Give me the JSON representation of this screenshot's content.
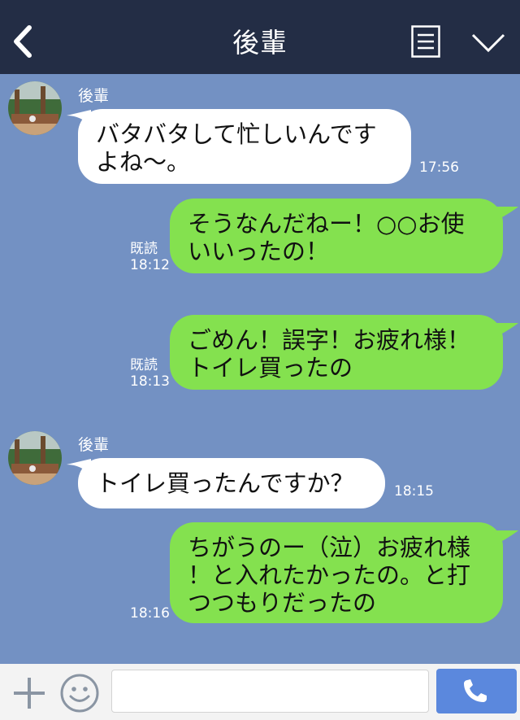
{
  "header": {
    "title": "後輩",
    "back_icon": "chevron-left-icon",
    "menu_icon": "menu-icon",
    "collapse_icon": "chevron-down-icon"
  },
  "messages": [
    {
      "from": "in",
      "sender": "後輩",
      "text": "バタバタして忙しいんです\nよね〜。",
      "time": "17:56"
    },
    {
      "from": "out",
      "text": "そうなんだねー！○○お使\nいいったの！",
      "read": "既読",
      "time": "18:12"
    },
    {
      "from": "out",
      "text": "ごめん！誤字！お疲れ様！\nトイレ買ったの",
      "read": "既読",
      "time": "18:13"
    },
    {
      "from": "in",
      "sender": "後輩",
      "text": "トイレ買ったんですか？",
      "time": "18:15"
    },
    {
      "from": "out",
      "text": "ちがうのー（泣）お疲れ様\n！と入れたかったの。と打\nつつもりだったの",
      "time": "18:16"
    }
  ],
  "footer": {
    "input_value": "",
    "plus_icon": "plus-icon",
    "sticker_icon": "smiley-icon",
    "call_icon": "phone-icon"
  },
  "colors": {
    "header": "#232d45",
    "background": "#7391c3",
    "outgoing": "#84e14f",
    "incoming": "#ffffff",
    "call_button": "#5b88dd"
  }
}
